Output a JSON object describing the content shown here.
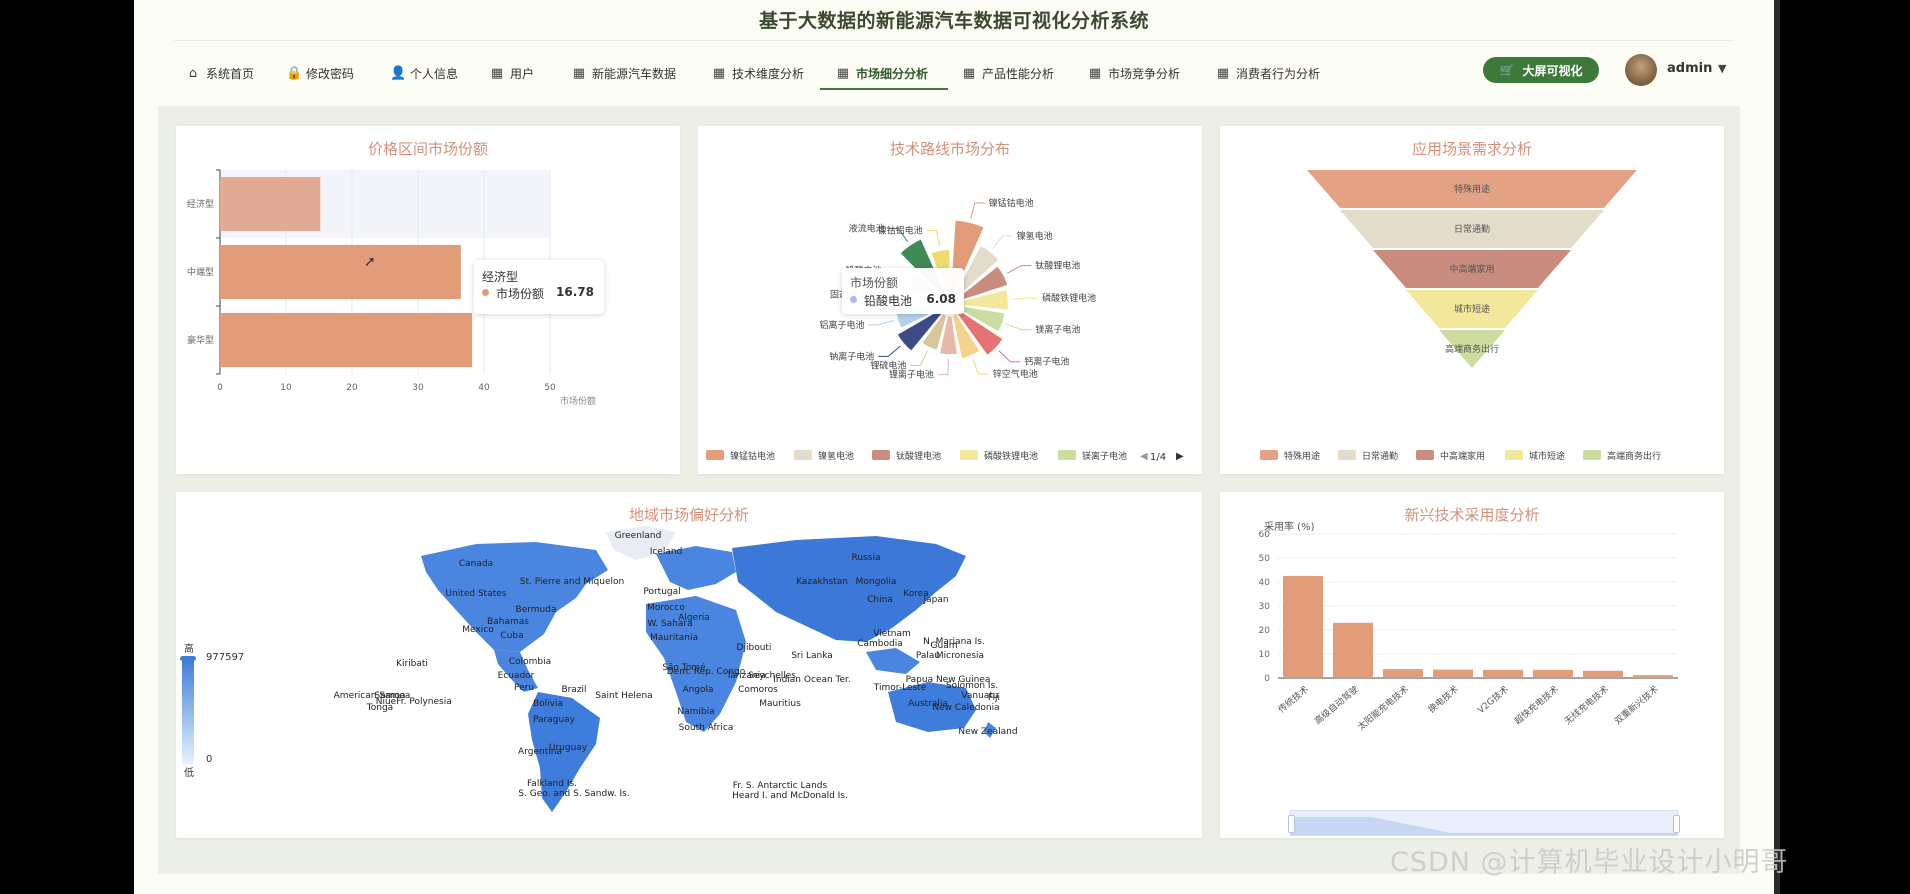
{
  "app_title": "基于大数据的新能源汽车数据可视化分析系统",
  "nav": [
    {
      "label": "系统首页",
      "icon": "⌂"
    },
    {
      "label": "修改密码",
      "icon": "🔒"
    },
    {
      "label": "个人信息",
      "icon": "👤"
    },
    {
      "label": "用户",
      "icon": "▦"
    },
    {
      "label": "新能源汽车数据",
      "icon": "▦"
    },
    {
      "label": "技术维度分析",
      "icon": "▦"
    },
    {
      "label": "市场细分分析",
      "icon": "▦"
    },
    {
      "label": "产品性能分析",
      "icon": "▦"
    },
    {
      "label": "市场竞争分析",
      "icon": "▦"
    },
    {
      "label": "消费者行为分析",
      "icon": "▦"
    }
  ],
  "active_nav": "市场细分分析",
  "big_screen_label": "大屏可视化",
  "username": "admin",
  "panels": {
    "price": {
      "title": "价格区间市场份额",
      "x_axis_name": "市场份额",
      "tooltip": {
        "category": "经济型",
        "series": "市场份额",
        "value": "16.78"
      }
    },
    "tech": {
      "title": "技术路线市场分布",
      "tooltip": {
        "title": "市场份额",
        "name": "铅酸电池",
        "value": "6.08"
      },
      "legend_page": "1/4"
    },
    "scene": {
      "title": "应用场景需求分析"
    },
    "map": {
      "title": "地域市场偏好分析",
      "visual_map": {
        "high_label": "高",
        "low_label": "低",
        "max": "977597",
        "min": "0"
      }
    },
    "emerging": {
      "title": "新兴技术采用度分析",
      "y_axis_name": "采用率 (%)"
    }
  },
  "chart_data": [
    {
      "type": "bar",
      "orientation": "horizontal",
      "title": "价格区间市场份额",
      "categories": [
        "经济型",
        "中端型",
        "豪华型"
      ],
      "values": [
        15.2,
        36.5,
        38.2
      ],
      "xlim": [
        0,
        50
      ],
      "xticks": [
        0,
        10,
        20,
        30,
        40,
        50
      ],
      "xlabel": "市场份额",
      "color": "#e29c7a"
    },
    {
      "type": "pie",
      "rose": true,
      "title": "技术路线市场分布",
      "labels": [
        "镍锰钴电池",
        "镍氢电池",
        "钛酸锂电池",
        "磷酸铁锂电池",
        "镁离子电池",
        "钙离子电池",
        "锌空气电池",
        "锂离子电池",
        "锂硫电池",
        "钠离子电池",
        "铝离子电池",
        "固态电池",
        "铅酸电池",
        "液流电池",
        "镍钴铝电池"
      ],
      "values": [
        9.2,
        7.8,
        7.4,
        7.2,
        7.0,
        7.6,
        7.0,
        6.6,
        6.4,
        7.4,
        6.9,
        6.6,
        6.08,
        8.2,
        6.9
      ],
      "colors": [
        "#e29c7a",
        "#e3dccb",
        "#c98d7f",
        "#f2e79b",
        "#cbdc9c",
        "#e57373",
        "#f2d48d",
        "#e8b9a8",
        "#d6c89a",
        "#3c4b86",
        "#b3d1ee",
        "#e4ecf8",
        "#b0b9e8",
        "#3f8a55",
        "#ecdc6e"
      ],
      "legend": [
        "镍锰钴电池",
        "镍氢电池",
        "钛酸锂电池",
        "磷酸铁锂电池",
        "镁离子电池"
      ]
    },
    {
      "type": "funnel",
      "title": "应用场景需求分析",
      "labels": [
        "特殊用途",
        "日常通勤",
        "中高端家用",
        "城市短途",
        "高端商务出行"
      ],
      "values": [
        100,
        80,
        60,
        40,
        20
      ],
      "colors": [
        "#e4a284",
        "#e3dccb",
        "#c98d7f",
        "#f2e79b",
        "#cbdc9c"
      ]
    },
    {
      "type": "map",
      "title": "地域市场偏好分析",
      "visual_map": {
        "min": 0,
        "max": 977597,
        "high": "高",
        "low": "低"
      },
      "country_labels": [
        "Greenland",
        "Iceland",
        "Russia",
        "Canada",
        "United States",
        "St. Pierre and Miquelon",
        "Kazakhstan",
        "Mongolia",
        "China",
        "Korea",
        "Japan",
        "Bermuda",
        "Portugal",
        "Morocco",
        "Algeria",
        "W. Sahara",
        "Mauritania",
        "Bahamas",
        "Mexico",
        "Cuba",
        "Colombia",
        "Ecuador",
        "Peru",
        "Brazil",
        "Bolivia",
        "Paraguay",
        "Uruguay",
        "Argentina",
        "Falkland Is.",
        "S. Geo. and S. Sandw. Is.",
        "Kiribati",
        "American Samoa",
        "Samoa",
        "Tonga",
        "Fr. Polynesia",
        "Niue",
        "Saint Helena",
        "São Tomé",
        "Dem. Rep. Congo",
        "Angola",
        "Namibia",
        "South Africa",
        "Tanzania",
        "Comoros",
        "Mauritius",
        "Seychelles",
        "Indian Ocean Ter.",
        "Sri Lanka",
        "Djibouti",
        "Cambodia",
        "Vietnam",
        "Palau",
        "Micronesia",
        "N. Mariana Is.",
        "Guam",
        "Papua New Guinea",
        "Solomon Is.",
        "Timor-Leste",
        "Vanuatu",
        "Fiji",
        "New Caledonia",
        "Australia",
        "New Zealand",
        "Fr. S. Antarctic Lands",
        "Heard I. and McDonald Is."
      ]
    },
    {
      "type": "bar",
      "title": "新兴技术采用度分析",
      "categories": [
        "传统技术",
        "高级自动驾驶",
        "太阳能充电技术",
        "换电技术",
        "V2G技术",
        "超快充电技术",
        "无线充电技术",
        "双重新兴技术"
      ],
      "values": [
        42.5,
        23.0,
        3.7,
        3.5,
        3.4,
        3.4,
        3.0,
        1.2
      ],
      "ylim": [
        0,
        60
      ],
      "yticks": [
        0,
        10,
        20,
        30,
        40,
        50,
        60
      ],
      "ylabel": "采用率 (%)",
      "color": "#e29c7a"
    }
  ],
  "watermark": "CSDN @计算机毕业设计小明哥"
}
